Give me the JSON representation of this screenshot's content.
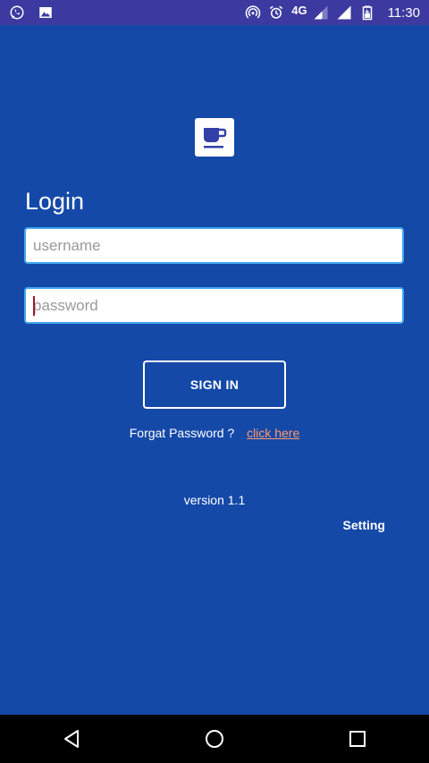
{
  "status_bar": {
    "time": "11:30",
    "network_type": "4G",
    "left_icons": [
      "whatsapp-icon",
      "image-icon"
    ],
    "right_icons": [
      "hotspot-icon",
      "alarm-icon",
      "signal-icon",
      "signal-icon",
      "battery-icon"
    ]
  },
  "login": {
    "title": "Login",
    "username_placeholder": "username",
    "password_placeholder": "password",
    "signin_label": "SIGN IN",
    "forgot_text": "Forgat Password ?",
    "click_here": "click here"
  },
  "footer": {
    "version": "version 1.1",
    "setting": "Setting"
  },
  "navbar": {
    "buttons": [
      "back-icon",
      "home-icon",
      "recents-icon"
    ]
  },
  "colors": {
    "background": "#1549a8",
    "status_bar": "#3c3aa0",
    "input_border": "#42a7f0",
    "link": "#ff9a6a"
  }
}
